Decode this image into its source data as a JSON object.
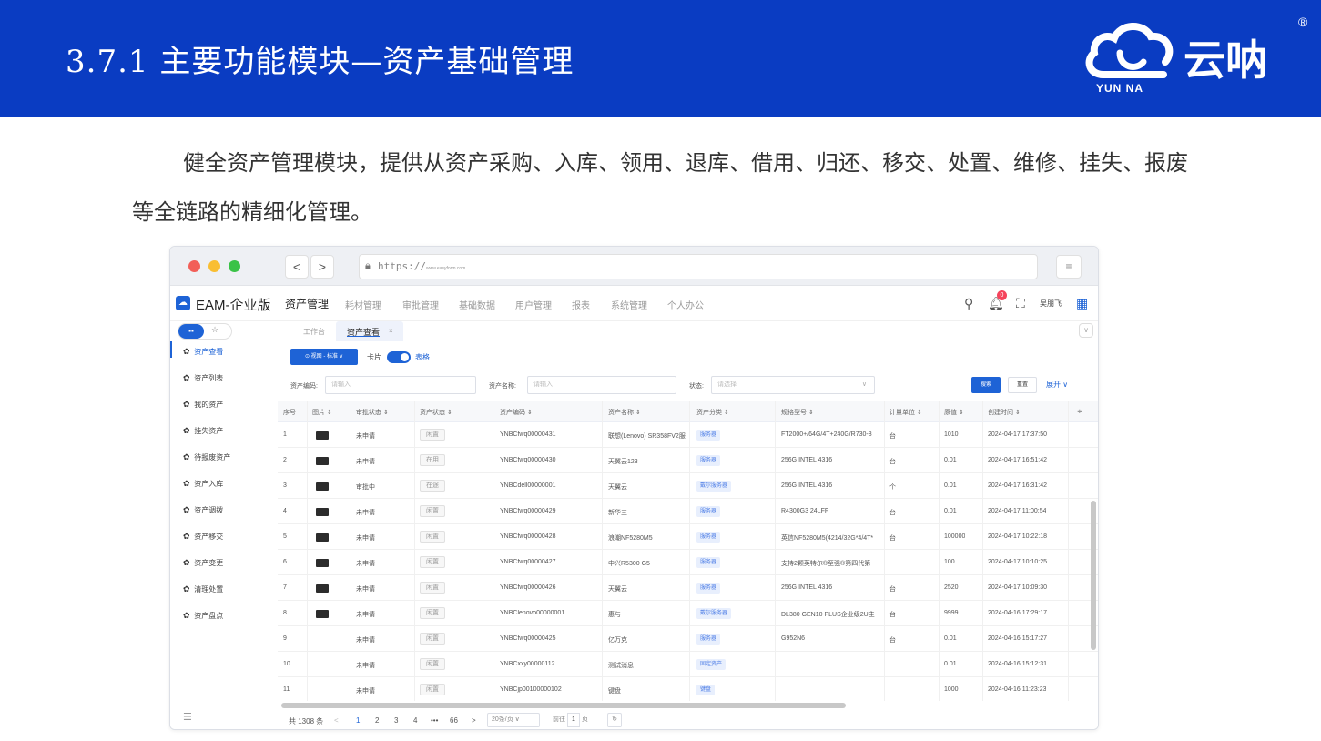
{
  "slide": {
    "title": "3.7.1 主要功能模块—资产基础管理",
    "brand_name": "云呐",
    "brand_sub": "YUN NA",
    "brand_reg": "®",
    "intro": "健全资产管理模块，提供从资产采购、入库、领用、退库、借用、归还、移交、处置、维修、挂失、报废等全链路的精细化管理。"
  },
  "browser": {
    "url_scheme": "https://",
    "url_host": "www.easyform.com",
    "back": "<",
    "forward": ">",
    "menu": "≡"
  },
  "app": {
    "name": "EAM-企业版",
    "nav": [
      "资产管理",
      "耗材管理",
      "审批管理",
      "基础数据",
      "用户管理",
      "报表",
      "系统管理",
      "个人办公"
    ],
    "notification_count": "0",
    "user": "吴朋飞"
  },
  "sidebar": {
    "items": [
      "资产查看",
      "资产列表",
      "我的资产",
      "挂失资产",
      "待报废资产",
      "资产入库",
      "资产调拨",
      "资产移交",
      "资产变更",
      "清理处置",
      "资产盘点"
    ]
  },
  "tabs": [
    "工作台",
    "资产查看"
  ],
  "toolbar": {
    "view": "⊙ 视图 - 标准 ∨",
    "card": "卡片",
    "table": "表格"
  },
  "filters": {
    "code_label": "资产编码:",
    "code_placeholder": "请输入",
    "name_label": "资产名称:",
    "name_placeholder": "请输入",
    "status_label": "状态:",
    "status_placeholder": "请选择",
    "search": "搜索",
    "reset": "重置",
    "expand": "展开 ∨"
  },
  "table": {
    "headers": [
      "序号",
      "图片 ⇕",
      "审批状态 ⇕",
      "资产状态 ⇕",
      "资产编码 ⇕",
      "资产名称 ⇕",
      "资产分类 ⇕",
      "规格型号 ⇕",
      "计量单位 ⇕",
      "原值 ⇕",
      "创建时间 ⇕"
    ],
    "rows": [
      {
        "no": "1",
        "img": true,
        "approval": "未申请",
        "status": "闲置",
        "code": "YNBCfwq00000431",
        "name": "联想(Lenovo) SR358FV2服",
        "category": "服务器",
        "spec": "FT2000+/64G/4T+240G/R730-8",
        "unit": "台",
        "value": "1010",
        "created": "2024-04-17 17:37:50"
      },
      {
        "no": "2",
        "img": true,
        "approval": "未申请",
        "status": "在用",
        "code": "YNBCfwq00000430",
        "name": "天翼云123",
        "category": "服务器",
        "spec": "256G INTEL 4316",
        "unit": "台",
        "value": "0.01",
        "created": "2024-04-17 16:51:42"
      },
      {
        "no": "3",
        "img": true,
        "approval": "审批中",
        "status": "在途",
        "code": "YNBCdell00000001",
        "name": "天翼云",
        "category": "戴尔服务器",
        "spec": "256G INTEL 4316",
        "unit": "个",
        "value": "0.01",
        "created": "2024-04-17 16:31:42"
      },
      {
        "no": "4",
        "img": true,
        "approval": "未申请",
        "status": "闲置",
        "code": "YNBCfwq00000429",
        "name": "新华三",
        "category": "服务器",
        "spec": "R4300G3 24LFF",
        "unit": "台",
        "value": "0.01",
        "created": "2024-04-17 11:00:54"
      },
      {
        "no": "5",
        "img": true,
        "approval": "未申请",
        "status": "闲置",
        "code": "YNBCfwq00000428",
        "name": "浪潮NF5280M5",
        "category": "服务器",
        "spec": "英信NF5280M5(4214/32G*4/4T*",
        "unit": "台",
        "value": "100000",
        "created": "2024-04-17 10:22:18"
      },
      {
        "no": "6",
        "img": true,
        "approval": "未申请",
        "status": "闲置",
        "code": "YNBCfwq00000427",
        "name": "中兴R5300 G5",
        "category": "服务器",
        "spec": "支持2颗英特尔®至强®第四代第",
        "unit": "",
        "value": "100",
        "created": "2024-04-17 10:10:25"
      },
      {
        "no": "7",
        "img": true,
        "approval": "未申请",
        "status": "闲置",
        "code": "YNBCfwq00000426",
        "name": "天翼云",
        "category": "服务器",
        "spec": "256G INTEL 4316",
        "unit": "台",
        "value": "2520",
        "created": "2024-04-17 10:09:30"
      },
      {
        "no": "8",
        "img": true,
        "approval": "未申请",
        "status": "闲置",
        "code": "YNBClenovo00000001",
        "name": "惠与",
        "category": "戴尔服务器",
        "spec": "DL380 GEN10 PLUS企业级2U主",
        "unit": "台",
        "value": "9999",
        "created": "2024-04-16 17:29:17"
      },
      {
        "no": "9",
        "img": false,
        "approval": "未申请",
        "status": "闲置",
        "code": "YNBCfwq00000425",
        "name": "亿万克",
        "category": "服务器",
        "spec": "G952N6",
        "unit": "台",
        "value": "0.01",
        "created": "2024-04-16 15:17:27"
      },
      {
        "no": "10",
        "img": false,
        "approval": "未申请",
        "status": "闲置",
        "code": "YNBCxxy00000112",
        "name": "测试消息",
        "category": "固定资产",
        "spec": "",
        "unit": "",
        "value": "0.01",
        "created": "2024-04-16 15:12:31"
      },
      {
        "no": "11",
        "img": false,
        "approval": "未申请",
        "status": "闲置",
        "code": "YNBCjp00100000102",
        "name": "键盘",
        "category": "键盘",
        "spec": "",
        "unit": "",
        "value": "1000",
        "created": "2024-04-16 11:23:23"
      }
    ]
  },
  "pager": {
    "total": "共 1308 条",
    "pages": [
      "1",
      "2",
      "3",
      "4",
      "•••",
      "66"
    ],
    "page_size": "20条/页 ∨",
    "goto_prefix": "前往",
    "goto_value": "1",
    "goto_suffix": "页"
  }
}
